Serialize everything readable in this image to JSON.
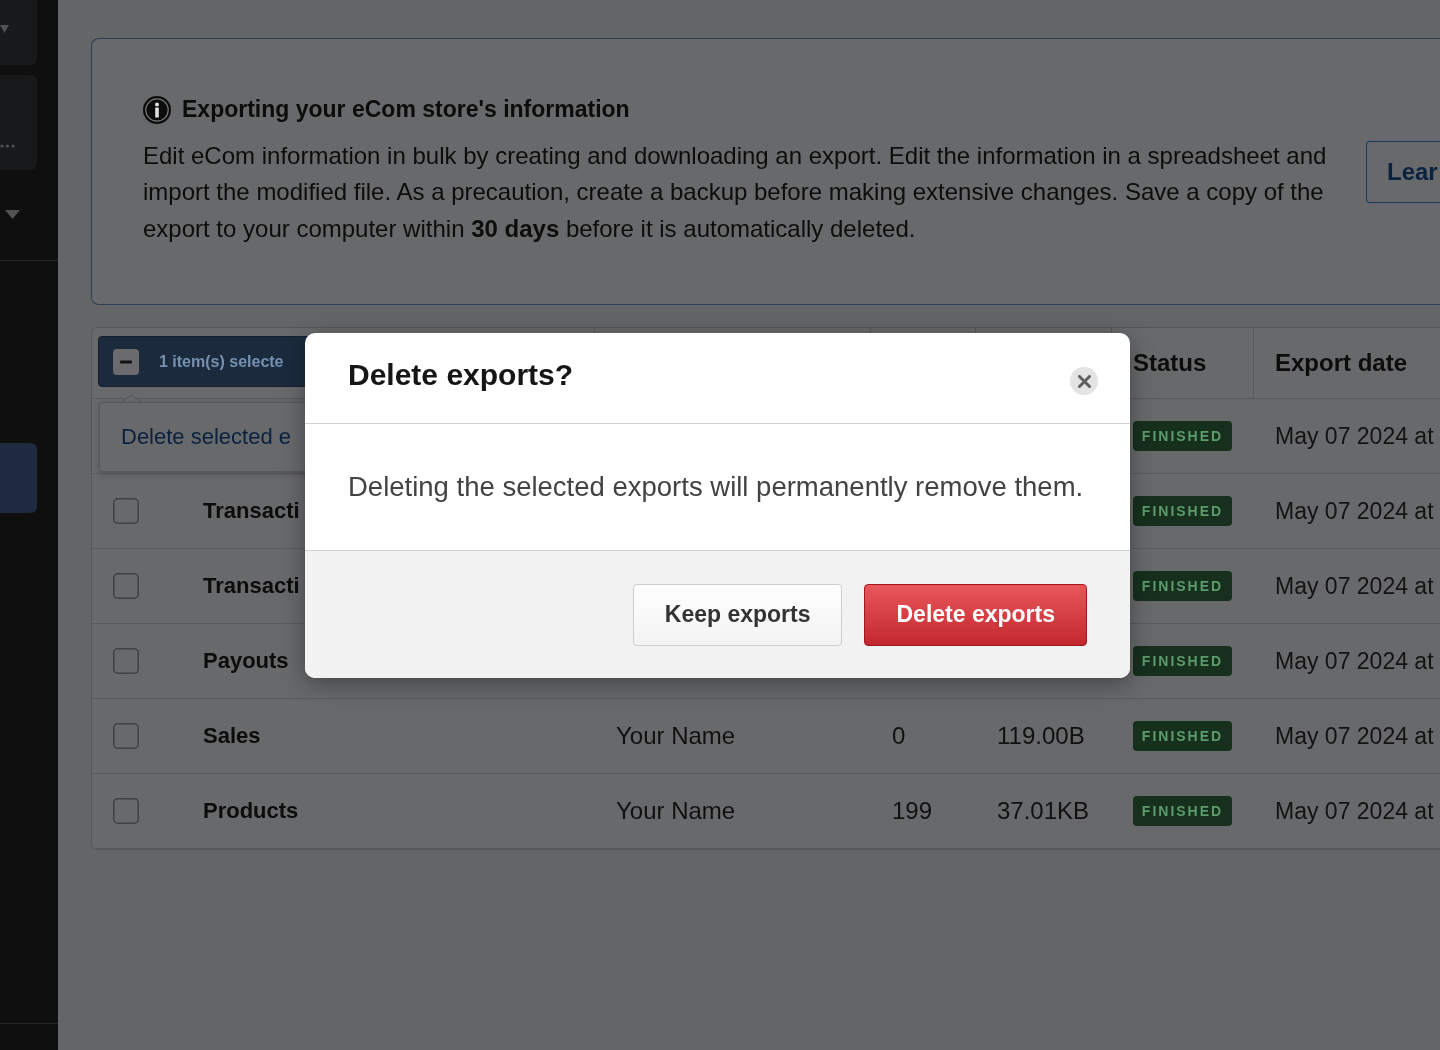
{
  "sidebar": {
    "items": [
      {
        "selected": true
      }
    ]
  },
  "banner": {
    "title": "Exporting your eCom store's information",
    "body": "Edit eCom information in bulk by creating and downloading an export. Edit the information in a spreadsheet and import the modified file. As a precaution, create a backup before making extensive changes. Save a copy of the export to your computer within **30 days** before it is automatically deleted.",
    "button": "Lear"
  },
  "table": {
    "selection": {
      "label": "1 item(s) selecte",
      "mixed": true
    },
    "popover": {
      "link": "Delete selected e"
    },
    "header": {
      "status": "Status",
      "export_date": "Export date"
    },
    "rows": [
      {
        "status": "FINISHED",
        "export_date": "May 07 2024 at"
      },
      {
        "checked": false,
        "column_2": "Transacti",
        "status": "FINISHED",
        "export_date": "May 07 2024 at"
      },
      {
        "checked": false,
        "column_2": "Transacti",
        "status": "FINISHED",
        "export_date": "May 07 2024 at"
      },
      {
        "checked": false,
        "column_2": "Payouts",
        "status": "FINISHED",
        "export_date": "May 07 2024 at"
      },
      {
        "checked": false,
        "column_2": "Sales",
        "column_3": "Your Name",
        "column_4": "0",
        "column_5": "119.00B",
        "status": "FINISHED",
        "export_date": "May 07 2024 at"
      },
      {
        "checked": false,
        "column_2": "Products",
        "column_3": "Your Name",
        "column_4": "199",
        "column_5": "37.01KB",
        "status": "FINISHED",
        "export_date": "May 07 2024 at"
      }
    ]
  },
  "modal": {
    "title": "Delete exports?",
    "message": "Deleting the selected exports will permanently remove them.",
    "buttons": [
      {
        "label": "Keep exports",
        "kind": "secondary"
      },
      {
        "label": "Delete exports",
        "kind": "danger"
      }
    ]
  }
}
